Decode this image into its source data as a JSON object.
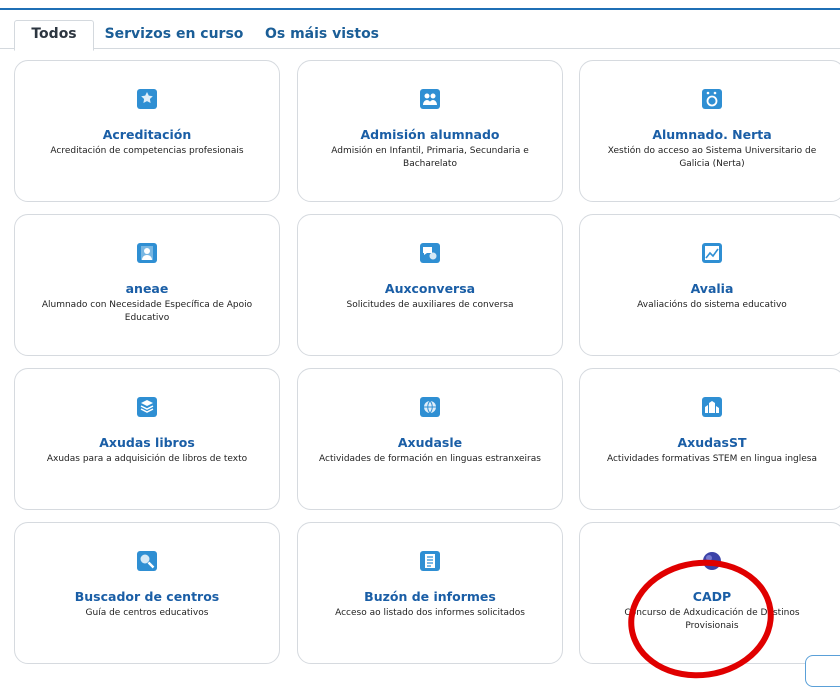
{
  "tabs": [
    {
      "label": "Todos",
      "active": true
    },
    {
      "label": "Servizos en curso",
      "active": false
    },
    {
      "label": "Os máis vistos",
      "active": false
    }
  ],
  "cards": [
    {
      "title": "Acreditación",
      "desc": "Acreditación de competencias profesionais",
      "icon": "badge-icon"
    },
    {
      "title": "Admisión alumnado",
      "desc": "Admisión en Infantil, Primaria, Secundaria e Bacharelato",
      "icon": "group-icon"
    },
    {
      "title": "Alumnado. Nerta",
      "desc": "Xestión do acceso ao Sistema Universitario de Galicia (Nerta)",
      "icon": "nerta-icon"
    },
    {
      "title": "aneae",
      "desc": "Alumnado con Necesidade Específica de Apoio Educativo",
      "icon": "person-icon"
    },
    {
      "title": "Auxconversa",
      "desc": "Solicitudes de auxiliares de conversa",
      "icon": "conversation-icon"
    },
    {
      "title": "Avalia",
      "desc": "Avaliacións do sistema educativo",
      "icon": "line-chart-icon"
    },
    {
      "title": "Axudas libros",
      "desc": "Axudas para a adquisición de libros de texto",
      "icon": "books-icon"
    },
    {
      "title": "Axudasle",
      "desc": "Actividades de formación en linguas estranxeiras",
      "icon": "globe-icon"
    },
    {
      "title": "AxudasST",
      "desc": "Actividades formativas STEM en lingua inglesa",
      "icon": "buildings-icon"
    },
    {
      "title": "Buscador de centros",
      "desc": "Guía de centros educativos",
      "icon": "search-icon"
    },
    {
      "title": "Buzón de informes",
      "desc": "Acceso ao listado dos informes solicitados",
      "icon": "report-icon"
    },
    {
      "title": "CADP",
      "desc": "Concurso de Adxudicación de Destinos Provisionais",
      "icon": "sphere-icon"
    }
  ],
  "colors": {
    "accent": "#1a5ea6",
    "icon": "#2f8fd3",
    "annotation": "#e00000"
  }
}
